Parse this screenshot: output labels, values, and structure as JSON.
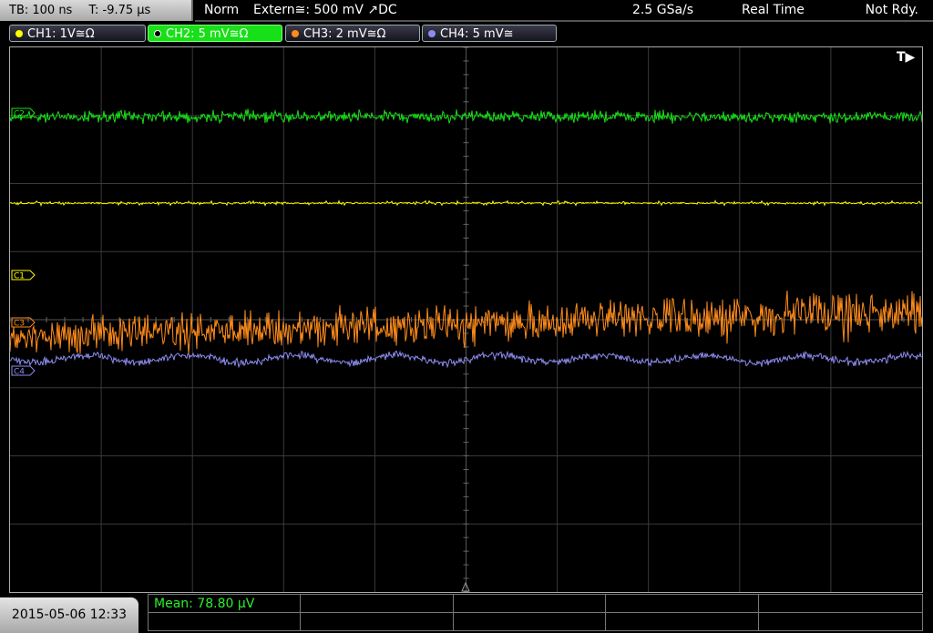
{
  "topbar": {
    "timebase": "TB: 100 ns",
    "trigger_time": "T: -9.75 µs",
    "trigger_mode": "Norm",
    "trigger_source": "Extern≅: 500 mV ↗DC",
    "sample_rate": "2.5 GSa/s",
    "acquisition": "Real Time",
    "status": "Not Rdy."
  },
  "channels": [
    {
      "label": "CH1: 1V≅Ω",
      "color": "#ffff00"
    },
    {
      "label": "CH2: 5 mV≅Ω",
      "color": "#18e018"
    },
    {
      "label": "CH3: 2 mV≅Ω",
      "color": "#ff8c1a"
    },
    {
      "label": "CH4: 5 mV≅",
      "color": "#8c8cf0"
    }
  ],
  "markers": {
    "trigger": "T▶",
    "c2": "C2",
    "c1": "C1",
    "c3": "C3",
    "c4": "C4"
  },
  "datetime": "2015-05-06 12:33",
  "measurement": "Mean: 78.80 µV",
  "colors": {
    "ch1": "#ffff00",
    "ch2": "#18e018",
    "ch3": "#ff8c1a",
    "ch4": "#8c8cf0",
    "grid": "#555555"
  }
}
